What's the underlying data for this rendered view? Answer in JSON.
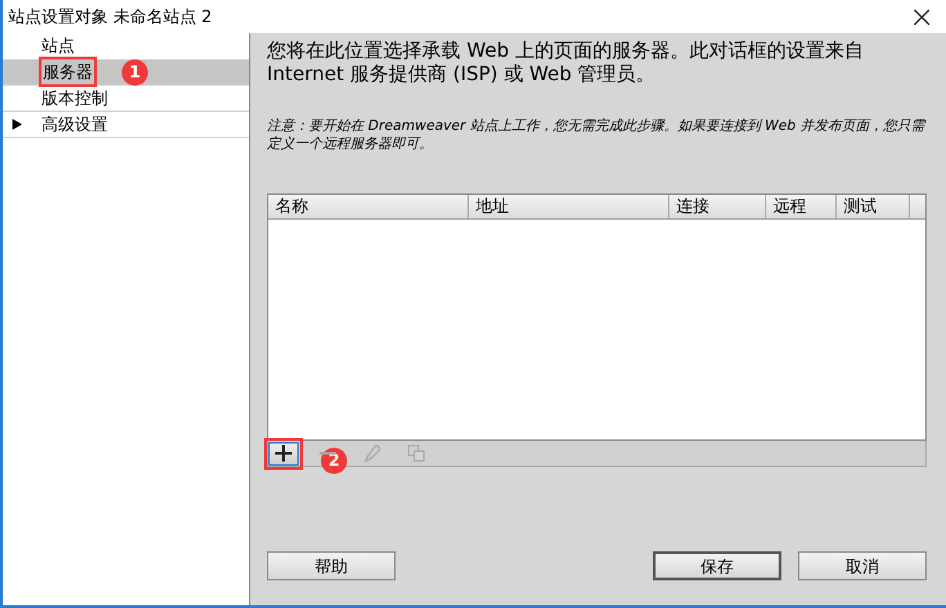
{
  "window": {
    "title": "站点设置对象 未命名站点 2"
  },
  "sidebar": {
    "items": [
      {
        "label": "站点",
        "selected": false
      },
      {
        "label": "服务器",
        "selected": true,
        "annotation": "1"
      },
      {
        "label": "版本控制",
        "selected": false
      },
      {
        "label": "高级设置",
        "selected": false,
        "expanded": false,
        "kind": "group"
      }
    ]
  },
  "intro": "您将在此位置选择承载 Web 上的页面的服务器。此对话框的设置来自 Internet 服务提供商 (ISP) 或 Web 管理员。",
  "note": "注意：要开始在 Dreamweaver 站点上工作，您无需完成此步骤。如果要连接到 Web 并发布页面，您只需定义一个远程服务器即可。",
  "table": {
    "columns": [
      "名称",
      "地址",
      "连接",
      "远程",
      "测试"
    ]
  },
  "toolbar": [
    {
      "kind": "add",
      "disabled": false,
      "annotation": "2"
    },
    {
      "kind": "remove",
      "disabled": true
    },
    {
      "kind": "edit",
      "disabled": true
    },
    {
      "kind": "duplicate",
      "disabled": true
    }
  ],
  "buttons": [
    {
      "label": "帮助",
      "default": false
    },
    {
      "label": "保存",
      "default": true
    },
    {
      "label": "取消",
      "default": false
    }
  ]
}
